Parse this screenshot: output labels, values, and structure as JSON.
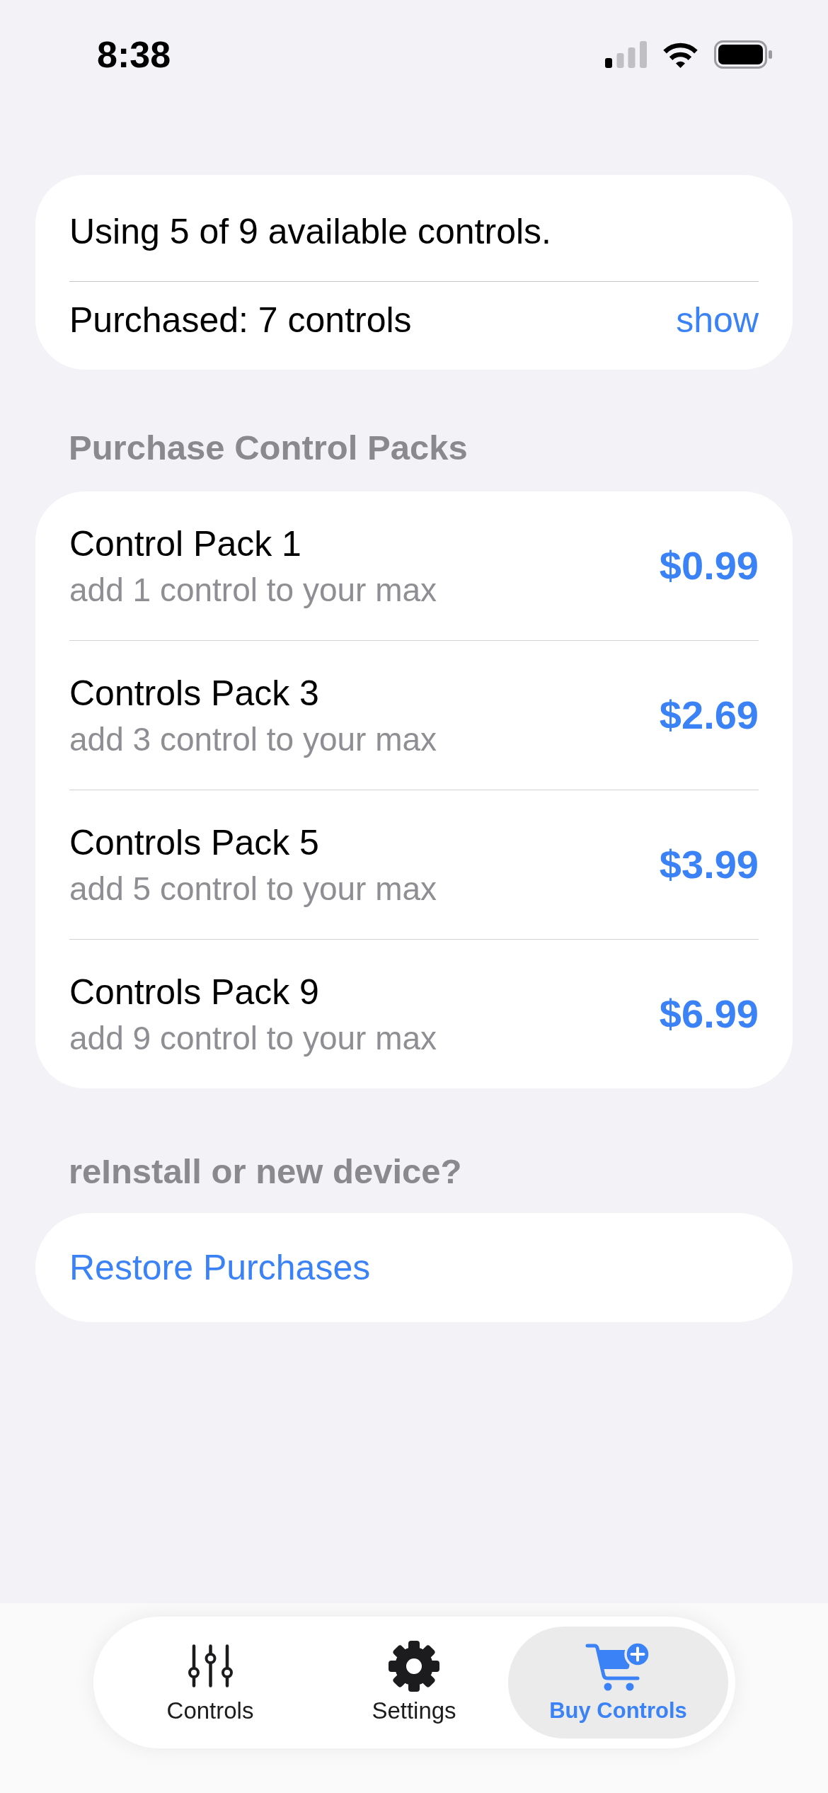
{
  "status_bar": {
    "time": "8:38"
  },
  "summary": {
    "usage_text": "Using 5 of 9 available controls.",
    "purchased_text": "Purchased: 7 controls",
    "show_link": "show"
  },
  "packs_section": {
    "header": "Purchase Control Packs",
    "packs": [
      {
        "title": "Control Pack 1",
        "subtitle": "add 1 control to your max",
        "price": "$0.99"
      },
      {
        "title": "Controls Pack 3",
        "subtitle": "add 3 control to your max",
        "price": "$2.69"
      },
      {
        "title": "Controls Pack 5",
        "subtitle": "add 5 control to your max",
        "price": "$3.99"
      },
      {
        "title": "Controls Pack 9",
        "subtitle": "add 9 control to your max",
        "price": "$6.99"
      }
    ]
  },
  "restore_section": {
    "header": "reInstall or new device?",
    "button": "Restore Purchases"
  },
  "tab_bar": {
    "tabs": [
      {
        "label": "Controls",
        "selected": false
      },
      {
        "label": "Settings",
        "selected": false
      },
      {
        "label": "Buy Controls",
        "selected": true
      }
    ]
  }
}
